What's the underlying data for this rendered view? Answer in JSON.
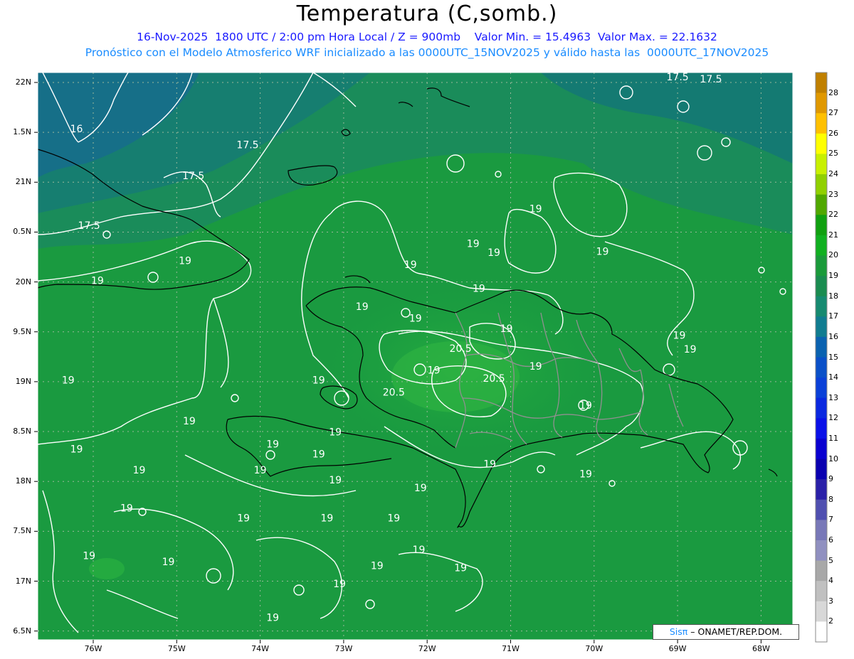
{
  "header": {
    "title": "Temperatura (C,somb.)",
    "subtitle_line1": "16-Nov-2025  1800 UTC / 2:00 pm Hora Local / Z = 900mb    Valor Min. = 15.4963  Valor Max. = 22.1632",
    "subtitle_line2": "Pronóstico con el Modelo Atmosferico WRF inicializado a las 0000UTC_15NOV2025 y válido hasta las  0000UTC_17NOV2025"
  },
  "axes": {
    "lat_labels": [
      "22N",
      "1.5N",
      "21N",
      "0.5N",
      "20N",
      "9.5N",
      "19N",
      "8.5N",
      "18N",
      "7.5N",
      "17N",
      "6.5N"
    ],
    "lat_values": [
      22,
      21.5,
      21,
      20.5,
      20,
      19.5,
      19,
      18.5,
      18,
      17.5,
      17,
      16.5
    ],
    "lon_labels": [
      "76W",
      "75W",
      "74W",
      "73W",
      "72W",
      "71W",
      "70W",
      "69W",
      "68W"
    ],
    "lon_values": [
      -76,
      -75,
      -74,
      -73,
      -72,
      -71,
      -70,
      -69,
      -68
    ]
  },
  "colorbar": {
    "labels": [
      "28",
      "27",
      "26",
      "25",
      "24",
      "23",
      "22",
      "21",
      "20",
      "19",
      "18",
      "17",
      "16",
      "15",
      "14",
      "13",
      "12",
      "11",
      "10",
      "9",
      "8",
      "7",
      "6",
      "5",
      "4",
      "3",
      "2"
    ],
    "colors": [
      "#c08000",
      "#e09800",
      "#ffc000",
      "#ffff00",
      "#c8f000",
      "#90d000",
      "#50a800",
      "#10a010",
      "#10b020",
      "#1a9a3a",
      "#1a8c50",
      "#168a70",
      "#107c90",
      "#0a62b0",
      "#0a50c8",
      "#0a40d8",
      "#0a28e0",
      "#0a10e8",
      "#0a00d0",
      "#0a00b0",
      "#2a20a8",
      "#5050b0",
      "#7878b8",
      "#9090c0",
      "#a8a8a8",
      "#c0c0c0",
      "#d8d8d8",
      "#ffffff"
    ]
  },
  "contour_labels": [
    {
      "text": "16",
      "lon": -76.2,
      "lat": 21.5
    },
    {
      "text": "17.5",
      "lon": -74.15,
      "lat": 21.34
    },
    {
      "text": "17.5",
      "lon": -74.8,
      "lat": 21.03
    },
    {
      "text": "17.5",
      "lon": -76.05,
      "lat": 20.53
    },
    {
      "text": "17.5",
      "lon": -69.0,
      "lat": 22.02
    },
    {
      "text": "17.5",
      "lon": -68.6,
      "lat": 22.0
    },
    {
      "text": "19",
      "lon": -70.7,
      "lat": 20.7
    },
    {
      "text": "19",
      "lon": -71.2,
      "lat": 20.26
    },
    {
      "text": "19",
      "lon": -71.45,
      "lat": 20.35
    },
    {
      "text": "19",
      "lon": -69.9,
      "lat": 20.27
    },
    {
      "text": "19",
      "lon": -72.2,
      "lat": 20.14
    },
    {
      "text": "19",
      "lon": -74.9,
      "lat": 20.18
    },
    {
      "text": "19",
      "lon": -75.95,
      "lat": 19.98
    },
    {
      "text": "19",
      "lon": -71.05,
      "lat": 19.5
    },
    {
      "text": "19",
      "lon": -71.38,
      "lat": 19.9
    },
    {
      "text": "19",
      "lon": -72.78,
      "lat": 19.72
    },
    {
      "text": "19",
      "lon": -72.14,
      "lat": 19.6
    },
    {
      "text": "19",
      "lon": -68.98,
      "lat": 19.43
    },
    {
      "text": "19",
      "lon": -68.85,
      "lat": 19.29
    },
    {
      "text": "19",
      "lon": -70.7,
      "lat": 19.12
    },
    {
      "text": "19",
      "lon": -71.92,
      "lat": 19.08
    },
    {
      "text": "19",
      "lon": -73.3,
      "lat": 18.98
    },
    {
      "text": "19",
      "lon": -76.3,
      "lat": 18.98
    },
    {
      "text": "19",
      "lon": -70.1,
      "lat": 18.73
    },
    {
      "text": "19",
      "lon": -74.85,
      "lat": 18.57
    },
    {
      "text": "19",
      "lon": -73.1,
      "lat": 18.46
    },
    {
      "text": "19",
      "lon": -73.85,
      "lat": 18.34
    },
    {
      "text": "19",
      "lon": -73.3,
      "lat": 18.24
    },
    {
      "text": "19",
      "lon": -71.25,
      "lat": 18.14
    },
    {
      "text": "19",
      "lon": -70.1,
      "lat": 18.04
    },
    {
      "text": "19",
      "lon": -75.45,
      "lat": 18.08
    },
    {
      "text": "19",
      "lon": -76.2,
      "lat": 18.29
    },
    {
      "text": "19",
      "lon": -74.0,
      "lat": 18.08
    },
    {
      "text": "19",
      "lon": -73.1,
      "lat": 17.98
    },
    {
      "text": "19",
      "lon": -72.08,
      "lat": 17.9
    },
    {
      "text": "19",
      "lon": -75.6,
      "lat": 17.7
    },
    {
      "text": "19",
      "lon": -73.2,
      "lat": 17.6
    },
    {
      "text": "19",
      "lon": -74.2,
      "lat": 17.6
    },
    {
      "text": "19",
      "lon": -72.4,
      "lat": 17.6
    },
    {
      "text": "19",
      "lon": -76.05,
      "lat": 17.22
    },
    {
      "text": "19",
      "lon": -75.1,
      "lat": 17.16
    },
    {
      "text": "19",
      "lon": -73.05,
      "lat": 16.94
    },
    {
      "text": "19",
      "lon": -72.1,
      "lat": 17.28
    },
    {
      "text": "19",
      "lon": -71.6,
      "lat": 17.1
    },
    {
      "text": "19",
      "lon": -72.6,
      "lat": 17.12
    },
    {
      "text": "19",
      "lon": -73.85,
      "lat": 16.6
    },
    {
      "text": "20.5",
      "lon": -71.6,
      "lat": 19.3
    },
    {
      "text": "20.5",
      "lon": -71.2,
      "lat": 19.0
    },
    {
      "text": "20.5",
      "lon": -72.4,
      "lat": 18.86
    }
  ],
  "credit": {
    "brand": "Sisπ",
    "org": "– ONAMET/REP.DOM."
  }
}
